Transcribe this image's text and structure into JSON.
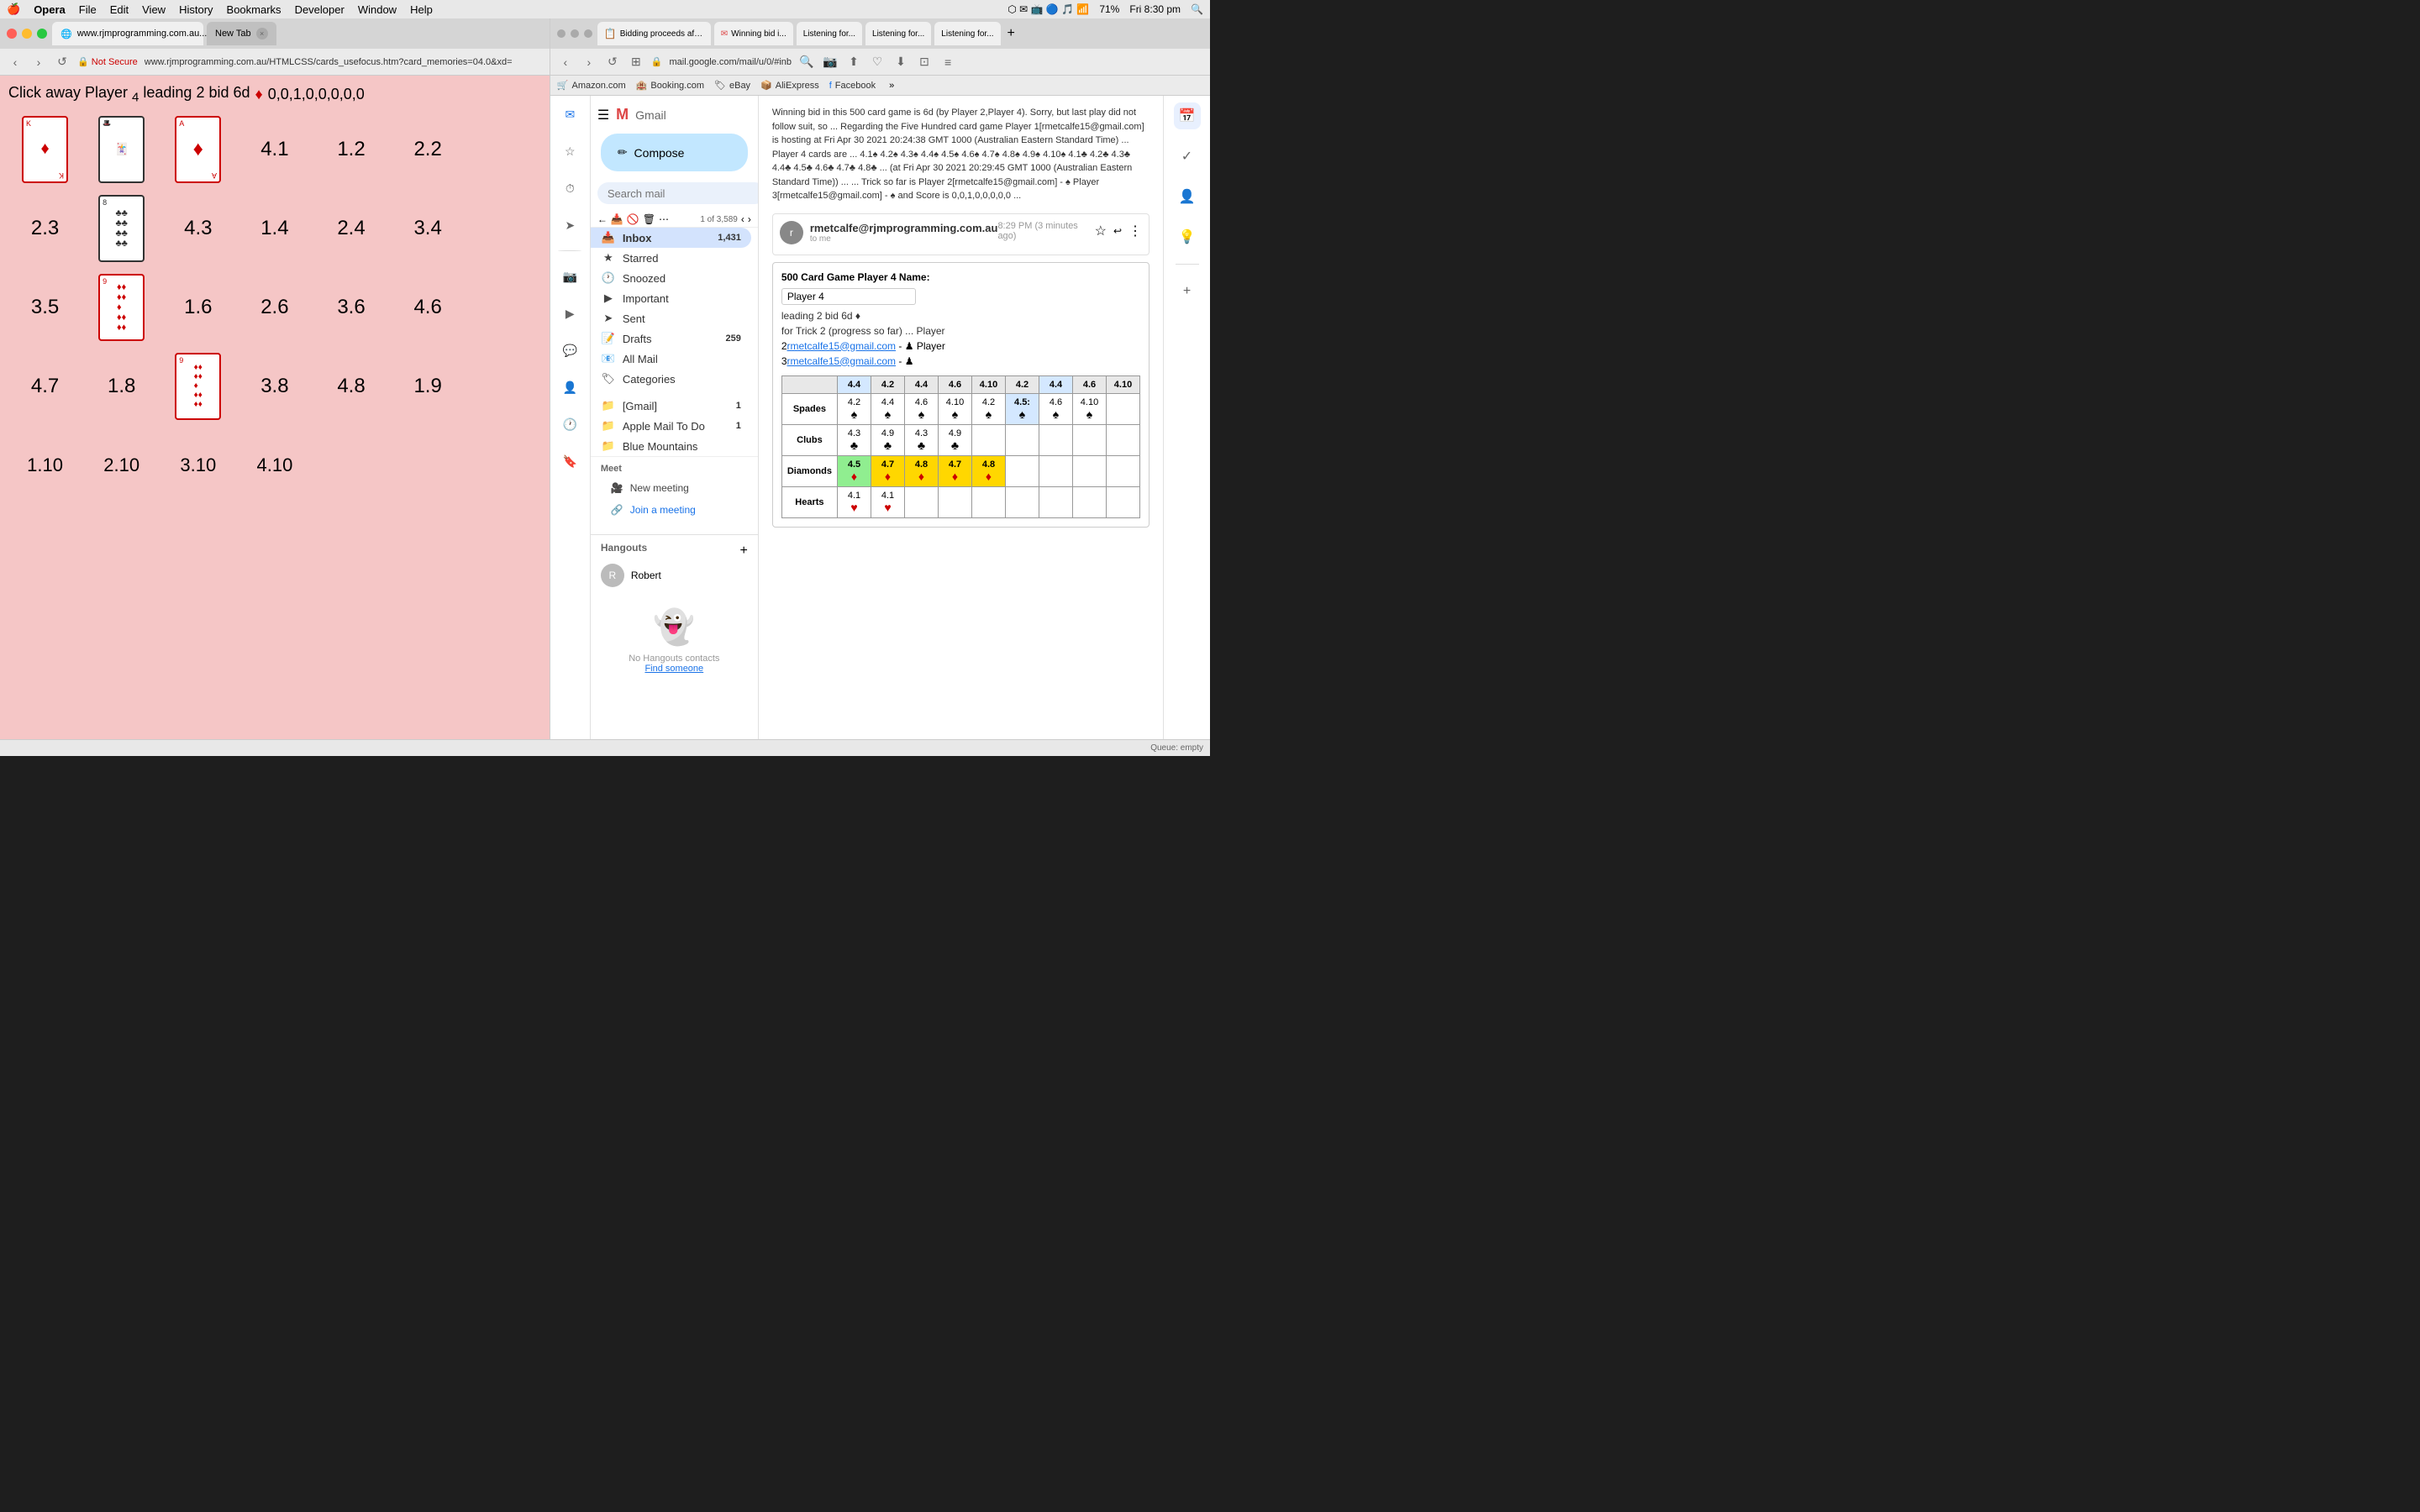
{
  "menubar": {
    "apple": "🍎",
    "items": [
      "Opera",
      "File",
      "Edit",
      "View",
      "History",
      "Bookmarks",
      "Developer",
      "Window",
      "Help"
    ],
    "right": {
      "battery": "71%",
      "time": "Fri 8:30 pm",
      "wifi": "●●●"
    }
  },
  "left_browser": {
    "url": "www.rjmprogramming.com.au/HTMLCSS/cards_usefocus.htm?card_memories=04.0&xd=",
    "tab1_label": "www.rjmprogramming.com.au...",
    "tab2_label": "New Tab",
    "security_label": "Not Secure",
    "game_header": "Click away Player 4 leading 2 bid 6d",
    "grid_values": [
      [
        "card_king_red",
        "card_joker",
        "card_ace_red",
        "4.1",
        "1.2",
        "2.2"
      ],
      [
        "2.3",
        "card_8_black",
        "4.3",
        "1.4",
        "2.4",
        "3.4"
      ],
      [
        "3.5",
        "card_9_red",
        "1.6",
        "2.6",
        "3.6",
        "4.6"
      ],
      [
        "4.7",
        "1.8",
        "card_9d_red",
        "3.8",
        "4.8",
        "1.9"
      ],
      [
        "1.10",
        "2.10",
        "3.10",
        "4.10",
        "",
        ""
      ]
    ]
  },
  "gmail": {
    "search_placeholder": "Search mail",
    "compose_label": "Compose",
    "toolbar_nav": "1 of 3,589",
    "tabs": [
      {
        "label": "Bidding proceeds after last No...",
        "favicon": "✉"
      },
      {
        "label": "Winning bid i...",
        "favicon": "✉"
      },
      {
        "label": "Listening for...",
        "favicon": "✉"
      },
      {
        "label": "Listening for...",
        "favicon": "✉"
      },
      {
        "label": "Listening for...",
        "favicon": "✉"
      }
    ],
    "sidebar": {
      "inbox_label": "Inbox",
      "inbox_count": "1,431",
      "starred_label": "Starred",
      "snoozed_label": "Snoozed",
      "important_label": "Important",
      "sent_label": "Sent",
      "drafts_label": "Drafts",
      "drafts_count": "259",
      "all_mail_label": "All Mail",
      "categories_label": "Categories",
      "gmail_label": "[Gmail]",
      "gmail_count": "1",
      "apple_mail_todo_label": "Apple Mail To Do",
      "apple_mail_count": "1",
      "blue_mountains_label": "Blue Mountains",
      "meet_label": "Meet",
      "new_meeting_label": "New meeting",
      "join_meeting_label": "Join a meeting",
      "hangouts_label": "Hangouts",
      "robert_label": "Robert",
      "no_hangouts_label": "No Hangouts contacts",
      "find_someone_label": "Find someone"
    },
    "email": {
      "subject": "Winning bid in this 500 card game is 6d (by Player 2,Player 4). Sorry, but last play did not follow suit, so ... Regarding the Five Hundred card game Player 1[rmetcalfe15@gmail.com] is hosting at Fri Apr 30 2021 20:24:38 GMT 1000 (Australian Eastern Standard Time) ... Player 4 cards are ... 4.1♠ 4.2♠ 4.3♠ 4.4♠ 4.5♠ 4.6♠ 4.7♠ 4.8♠ 4.9♠ 4.10♠ 4.1♣ 4.2♣ 4.3♣ 4.4♣ 4.5♣ 4.6♣ 4.7♣ 4.8♣ ... (at Fri Apr 30 2021 20:29:45 GMT 1000 (Australian Eastern Standard Time)) ... ... Trick so far is Player 2[rmetcalfe15@gmail.com] - ♠ Player 3[rmetcalfe15@gmail.com] - ♠ and Score is 0,0,1,0,0,0,0,0 ...",
      "sender": "rmetcalfe@rjmprogramming.com.au",
      "sender_short": "rmetcalfe@rjmprogramming.com.au",
      "timestamp": "8:29 PM (3 minutes ago)",
      "to": "to me",
      "body_text": "500 Card Game Player 4 Name:",
      "player_name": "Player 4",
      "bid_line": "leading 2 bid 6d ♦",
      "trick_line": "for Trick 2 (progress so far) ... Player",
      "player2_email": "rmetcalfe15@gmail.com",
      "dash1": "- ♠ Player",
      "player3_email": "rmetcalfe15@gmail.com",
      "dash2": "- ♠"
    },
    "card_table": {
      "headers": [
        "",
        "",
        "4.2",
        "4.4",
        "4.6",
        "4.10",
        "4.2",
        "4.4",
        "4.6",
        "4.10"
      ],
      "rows": [
        {
          "label": "Spades",
          "cells": [
            {
              "val": "4.2",
              "bg": "white",
              "sym": "♠"
            },
            {
              "val": "4.4",
              "bg": "white",
              "sym": "♠"
            },
            {
              "val": "4.6",
              "bg": "white",
              "sym": "♠"
            },
            {
              "val": "4.10",
              "bg": "white",
              "sym": "♠"
            },
            {
              "val": "4.2",
              "bg": "white",
              "sym": "♠"
            },
            {
              "val": "4.5:",
              "bg": "white",
              "sym": "♠"
            },
            {
              "val": "4.6",
              "bg": "white",
              "sym": "♠"
            },
            {
              "val": "4.10",
              "bg": "white",
              "sym": "♠"
            }
          ]
        },
        {
          "label": "Clubs",
          "cells": [
            {
              "val": "4.3",
              "bg": "white",
              "sym": "♣"
            },
            {
              "val": "4.9",
              "bg": "white",
              "sym": "♣"
            },
            {
              "val": "4.3",
              "bg": "white",
              "sym": "♣"
            },
            {
              "val": "4.9",
              "bg": "white",
              "sym": "♣"
            },
            {
              "val": "",
              "bg": "white",
              "sym": ""
            },
            {
              "val": "",
              "bg": "white",
              "sym": ""
            },
            {
              "val": "",
              "bg": "white",
              "sym": ""
            },
            {
              "val": "",
              "bg": "white",
              "sym": ""
            }
          ]
        },
        {
          "label": "Diamonds",
          "cells": [
            {
              "val": "4.5",
              "bg": "green",
              "sym": "♦"
            },
            {
              "val": "4.7",
              "bg": "yellow",
              "sym": "♦"
            },
            {
              "val": "4.8",
              "bg": "yellow",
              "sym": "♦"
            },
            {
              "val": "4.7",
              "bg": "yellow",
              "sym": "♦"
            },
            {
              "val": "4.8",
              "bg": "yellow",
              "sym": "♦"
            },
            {
              "val": "",
              "bg": "white",
              "sym": ""
            },
            {
              "val": "",
              "bg": "white",
              "sym": ""
            },
            {
              "val": "",
              "bg": "white",
              "sym": ""
            }
          ]
        },
        {
          "label": "Hearts",
          "cells": [
            {
              "val": "4.1",
              "bg": "white",
              "sym": "♥"
            },
            {
              "val": "4.1",
              "bg": "white",
              "sym": "♥"
            },
            {
              "val": "",
              "bg": "white",
              "sym": ""
            },
            {
              "val": "",
              "bg": "white",
              "sym": ""
            },
            {
              "val": "",
              "bg": "white",
              "sym": ""
            },
            {
              "val": "",
              "bg": "white",
              "sym": ""
            },
            {
              "val": "",
              "bg": "white",
              "sym": ""
            },
            {
              "val": "",
              "bg": "white",
              "sym": ""
            }
          ]
        }
      ]
    }
  },
  "bookmarks": [
    {
      "label": "Amazon.com",
      "color": "#ff9900"
    },
    {
      "label": "Booking.com",
      "color": "#003580"
    },
    {
      "label": "eBay",
      "color": "#e53238"
    },
    {
      "label": "AliExpress",
      "color": "#ff6600"
    },
    {
      "label": "Facebook",
      "color": "#1877f2"
    }
  ],
  "bottom_bar": {
    "left": "",
    "right": "Queue: empty"
  }
}
